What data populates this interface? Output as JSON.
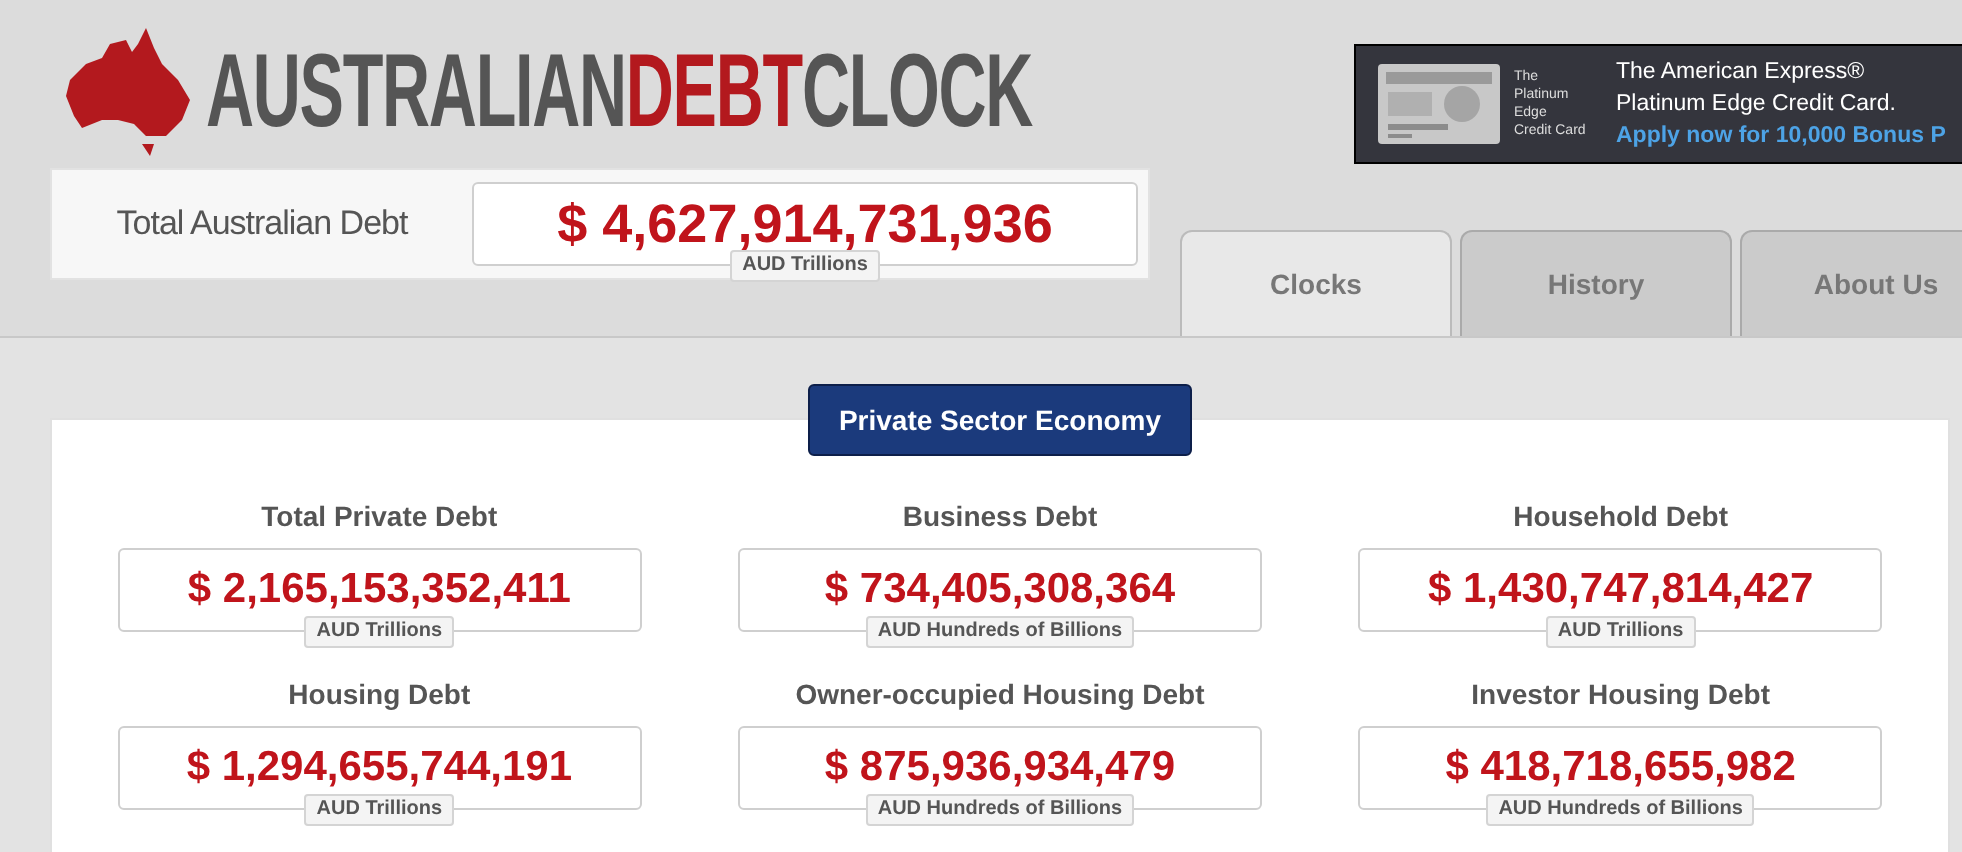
{
  "logo": {
    "parts": [
      {
        "text": "AUSTRALIAN",
        "color": "#555555"
      },
      {
        "text": "DEBT",
        "color": "#b3191e"
      },
      {
        "text": "CLOCK",
        "color": "#555555"
      }
    ]
  },
  "ad": {
    "card_caption": [
      "The",
      "Platinum Edge",
      "Credit Card"
    ],
    "title_lines": [
      "The American Express®",
      "Platinum Edge Credit Card."
    ],
    "link": "Apply now for 10,000 Bonus P"
  },
  "total": {
    "label": "Total Australian Debt",
    "value": "$ 4,627,914,731,936",
    "unit": "AUD Trillions"
  },
  "tabs": [
    {
      "label": "Clocks",
      "selected": true
    },
    {
      "label": "History",
      "selected": false
    },
    {
      "label": "About Us",
      "selected": false
    }
  ],
  "section_button": "Private Sector Economy",
  "clocks": [
    {
      "label": "Total Private Debt",
      "value": "$ 2,165,153,352,411",
      "unit": "AUD Trillions"
    },
    {
      "label": "Business Debt",
      "value": "$ 734,405,308,364",
      "unit": "AUD Hundreds of Billions"
    },
    {
      "label": "Household Debt",
      "value": "$ 1,430,747,814,427",
      "unit": "AUD Trillions"
    },
    {
      "label": "Housing Debt",
      "value": "$ 1,294,655,744,191",
      "unit": "AUD Trillions"
    },
    {
      "label": "Owner-occupied Housing Debt",
      "value": "$ 875,936,934,479",
      "unit": "AUD Hundreds of Billions"
    },
    {
      "label": "Investor Housing Debt",
      "value": "$ 418,718,655,982",
      "unit": "AUD Hundreds of Billions"
    }
  ]
}
